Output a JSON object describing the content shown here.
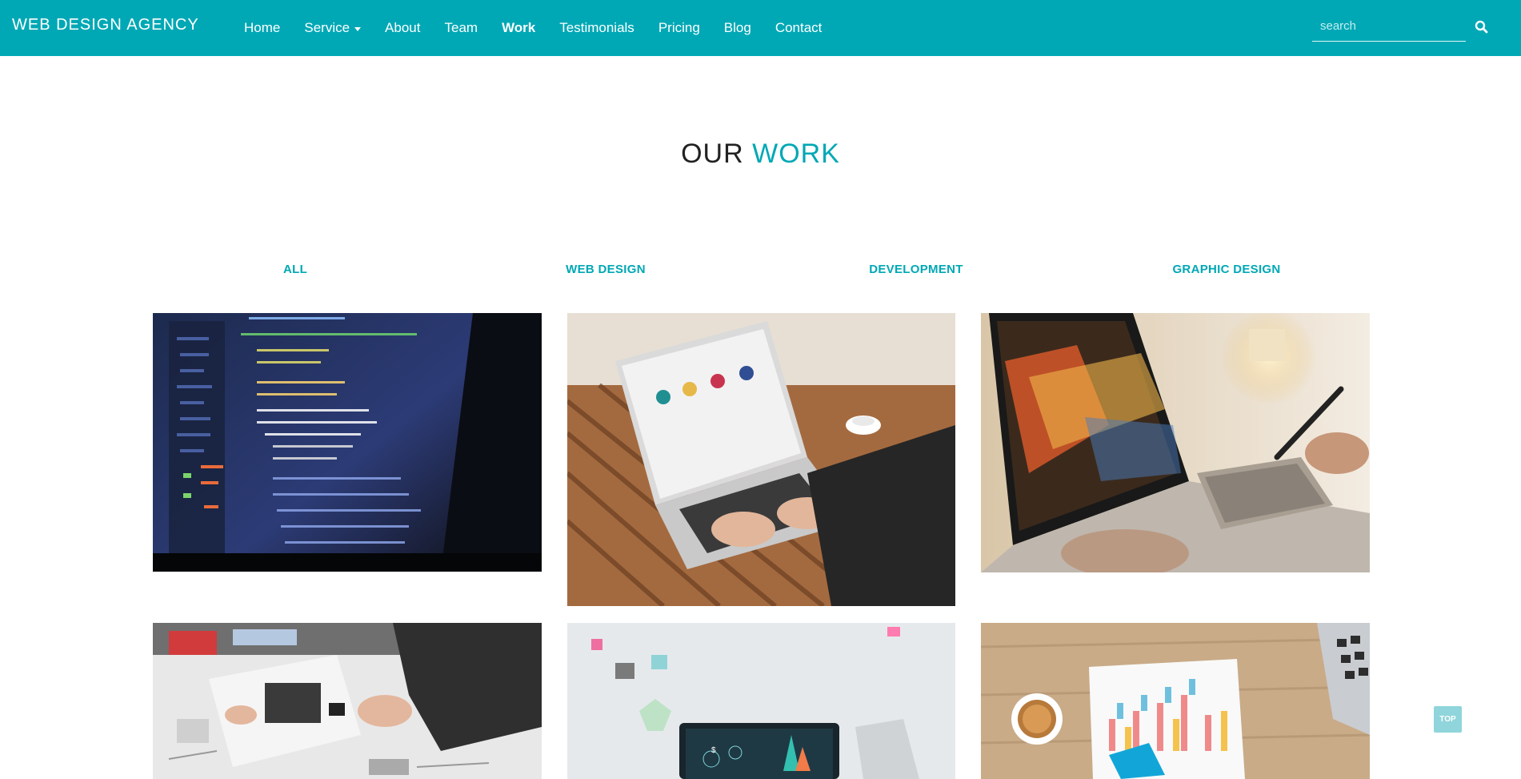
{
  "brand": "WEB DESIGN AGENCY",
  "nav": {
    "items": [
      {
        "label": "Home"
      },
      {
        "label": "Service"
      },
      {
        "label": "About"
      },
      {
        "label": "Team"
      },
      {
        "label": "Work"
      },
      {
        "label": "Testimonials"
      },
      {
        "label": "Pricing"
      },
      {
        "label": "Blog"
      },
      {
        "label": "Contact"
      }
    ],
    "active": "Work"
  },
  "search": {
    "placeholder": "search",
    "icon": "search-icon"
  },
  "section": {
    "title_prefix": "OUR",
    "title_accent": "WORK"
  },
  "filters": [
    "ALL",
    "WEB DESIGN",
    "DEVELOPMENT",
    "GRAPHIC DESIGN"
  ],
  "portfolio": [
    {
      "subject": "code-on-monitor"
    },
    {
      "subject": "laptop-on-wooden-table"
    },
    {
      "subject": "graphic-tablet-laptop"
    },
    {
      "subject": "design-sketches-table"
    },
    {
      "subject": "laptop-analytics-dashboard"
    },
    {
      "subject": "charts-report-with-coffee"
    }
  ],
  "colors": {
    "primary": "#00a8b5",
    "top_button": "#8fd5db"
  },
  "back_to_top": "TOP"
}
